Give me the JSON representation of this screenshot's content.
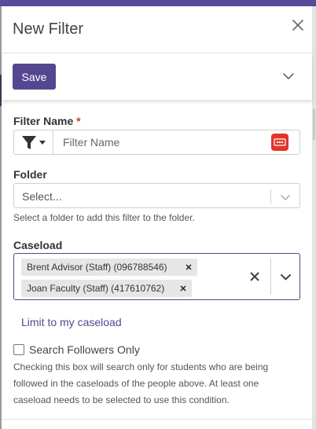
{
  "dialog": {
    "title": "New Filter"
  },
  "actions": {
    "save_label": "Save"
  },
  "filter_name": {
    "label": "Filter Name",
    "required_mark": "*",
    "placeholder": "Filter Name"
  },
  "folder": {
    "label": "Folder",
    "placeholder": "Select...",
    "help": "Select a folder to add this filter to the folder."
  },
  "caseload": {
    "label": "Caseload",
    "chips": [
      {
        "text": "Brent Advisor (Staff) (096788546)"
      },
      {
        "text": "Joan Faculty (Staff) (417610762)"
      }
    ],
    "limit_link": "Limit to my caseload"
  },
  "followers": {
    "checkbox_label": "Search Followers Only",
    "help_lines": [
      "Checking this box will search only for students who are being",
      "followed in the caseloads of the people above. At least one",
      "caseload needs to be selected to use this condition."
    ]
  },
  "colors": {
    "accent": "#55478f",
    "topbar": "#5b4a9c",
    "required": "#c0392b",
    "password_icon": "#e0352b"
  },
  "icons": {
    "close": "close-icon",
    "expand": "chevron-down-icon",
    "filter": "funnel-icon",
    "password": "password-manager-icon"
  }
}
